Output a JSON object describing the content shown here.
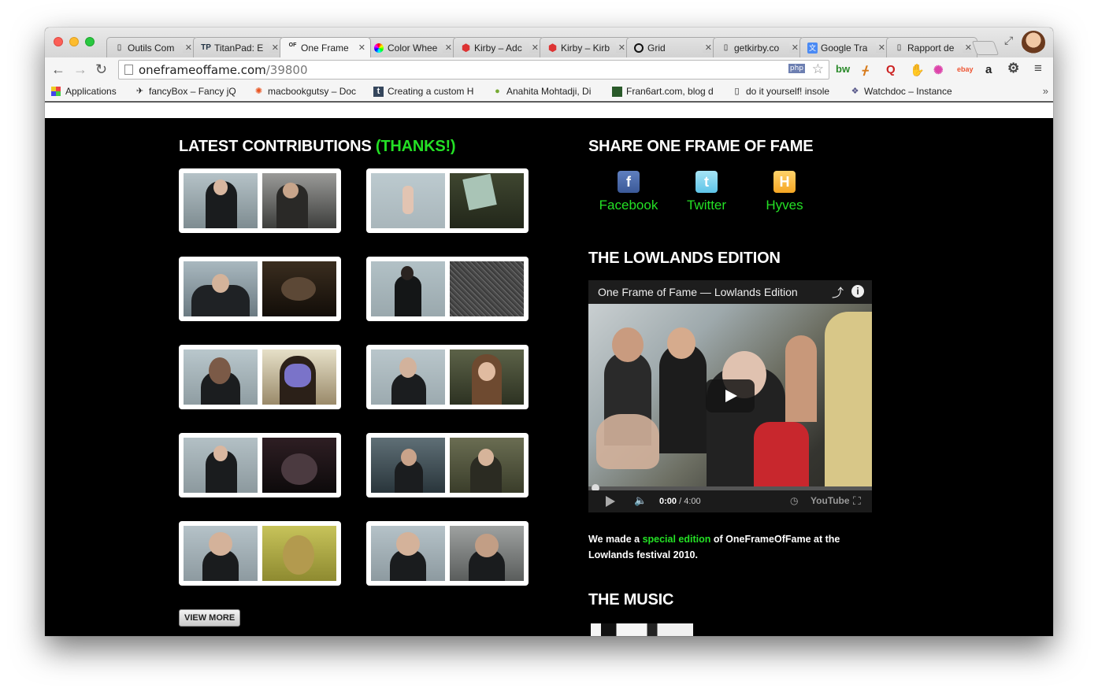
{
  "browser": {
    "tabs": [
      {
        "label": "Outils Com",
        "icon": "page-icon"
      },
      {
        "label": "TitanPad: E",
        "icon": "titanpad-icon"
      },
      {
        "label": "One Frame",
        "icon": "oneframe-icon"
      },
      {
        "label": "Color Whee",
        "icon": "color-wheel-icon"
      },
      {
        "label": "Kirby – Adc",
        "icon": "kirby-icon"
      },
      {
        "label": "Kirby – Kirb",
        "icon": "kirby-icon"
      },
      {
        "label": "Grid",
        "icon": "grid-icon"
      },
      {
        "label": "getkirby.co",
        "icon": "page-icon"
      },
      {
        "label": "Google Tra",
        "icon": "google-translate-icon"
      },
      {
        "label": "Rapport de",
        "icon": "page-icon"
      }
    ],
    "active_tab_index": 2,
    "url_host": "oneframeoffame.com",
    "url_path": "/39800",
    "omnibox_badge": "php",
    "bookmarks": [
      {
        "label": "Applications",
        "icon": "apps-grid-icon"
      },
      {
        "label": "fancyBox – Fancy jQ",
        "icon": "fancybox-icon"
      },
      {
        "label": "macbookgutsy – Doc",
        "icon": "ubuntu-icon"
      },
      {
        "label": "Creating a custom H",
        "icon": "tumblr-icon"
      },
      {
        "label": "Anahita Mohtadji, Di",
        "icon": "apple-icon"
      },
      {
        "label": "Fran6art.com, blog d",
        "icon": "blog-icon"
      },
      {
        "label": "do it yourself! insole",
        "icon": "page-icon"
      },
      {
        "label": "Watchdoc – Instance",
        "icon": "watchdoc-icon"
      }
    ],
    "bookmarks_more": "»",
    "extensions": [
      "bw",
      "ᚋ",
      "Q",
      "✋",
      "✺",
      "ebay",
      "a",
      "⚙",
      "≡"
    ]
  },
  "page": {
    "latest": {
      "title": "LATEST CONTRIBUTIONS",
      "title_highlight": "(THANKS!)"
    },
    "share": {
      "title": "SHARE ONE FRAME OF FAME",
      "items": [
        {
          "label": "Facebook",
          "glyph": "f",
          "color": "#3b5998"
        },
        {
          "label": "Twitter",
          "glyph": "t",
          "color": "#5ec4e8"
        },
        {
          "label": "Hyves",
          "glyph": "H",
          "color": "#f5a623"
        }
      ]
    },
    "lowlands": {
      "title": "THE LOWLANDS EDITION",
      "video_title": "One Frame of Fame — Lowlands Edition",
      "time_current": "0:00",
      "time_total": "/ 4:00",
      "youtube_label": "YouTube",
      "text_before": "We made a ",
      "text_link": "special edition",
      "text_after": " of OneFrameOfFame at the Lowlands festival 2010."
    },
    "music_title": "THE MUSIC",
    "view_more": "VIEW MORE"
  }
}
